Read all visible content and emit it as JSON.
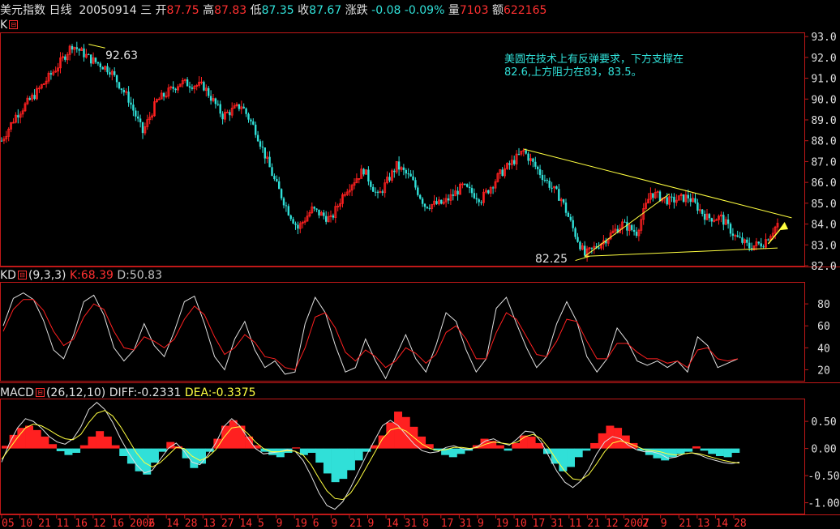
{
  "header": {
    "name": "美元指数 日线",
    "date": "20050914",
    "weekday": "三",
    "open_label": "开",
    "open": "87.75",
    "high_label": "高",
    "high": "87.83",
    "low_label": "低",
    "low": "87.35",
    "close_label": "收",
    "close": "87.67",
    "change_label": "涨跌",
    "change": "-0.08",
    "change_pct": "-0.09%",
    "volume_label": "量",
    "volume": "7103",
    "amount_label": "额",
    "amount": "622165"
  },
  "k_panel": {
    "label": "K",
    "annotation_lines": [
      "美圆在技术上有反弹要求，下方支撑在",
      "82.6,上方阻力在83，83.5。"
    ],
    "high_marker": "92.63",
    "low_marker": "82.25"
  },
  "kd_panel": {
    "label": "KD",
    "params": "(9,3,3)",
    "k_label": "K:68.39",
    "d_label": "D:50.83"
  },
  "macd_panel": {
    "label": "MACD",
    "params": "(26,12,10)",
    "diff_label": "DIFF:-0.2331",
    "dea_label": "DEA:-0.3375"
  },
  "x_axis_labels": [
    "05",
    "10",
    "21",
    "11",
    "16",
    "12",
    "16",
    "2006",
    "2",
    "14",
    "28",
    "13",
    "27",
    "14",
    "5",
    "9",
    "19",
    "6",
    "9",
    "21",
    "9",
    "14",
    "31",
    "8",
    "17",
    "31",
    "9",
    "19",
    "10",
    "17",
    "31",
    "11",
    "21",
    "12",
    "2007",
    "2",
    "9",
    "21",
    "13",
    "14",
    "28"
  ],
  "colors": {
    "up": "#ff2020",
    "down": "#30e0d8",
    "axis": "#c01818",
    "k_line": "#e0e0e0",
    "d_line": "#ff2020",
    "dea_line": "#ffff40",
    "trend": "#ffff40"
  },
  "chart_data": [
    {
      "type": "candlestick",
      "ylim": [
        82.0,
        93.2
      ],
      "yticks": [
        "93.0",
        "92.0",
        "91.0",
        "90.0",
        "89.0",
        "88.0",
        "87.0",
        "86.0",
        "85.0",
        "84.0",
        "83.0",
        "82.0"
      ],
      "points": [
        [
          0,
          88.0
        ],
        [
          6,
          89.2
        ],
        [
          14,
          90.2
        ],
        [
          24,
          91.6
        ],
        [
          30,
          92.6
        ],
        [
          38,
          91.9
        ],
        [
          46,
          91.4
        ],
        [
          54,
          90.0
        ],
        [
          60,
          88.4
        ],
        [
          66,
          89.9
        ],
        [
          76,
          90.8
        ],
        [
          86,
          90.6
        ],
        [
          94,
          89.2
        ],
        [
          102,
          89.7
        ],
        [
          108,
          88.5
        ],
        [
          116,
          86.1
        ],
        [
          122,
          84.6
        ],
        [
          126,
          83.8
        ],
        [
          132,
          84.7
        ],
        [
          140,
          84.2
        ],
        [
          146,
          85.6
        ],
        [
          154,
          86.6
        ],
        [
          160,
          85.3
        ],
        [
          168,
          86.8
        ],
        [
          174,
          86.2
        ],
        [
          180,
          84.9
        ],
        [
          188,
          85.0
        ],
        [
          196,
          85.8
        ],
        [
          204,
          85.2
        ],
        [
          212,
          86.4
        ],
        [
          222,
          87.5
        ],
        [
          230,
          86.3
        ],
        [
          238,
          85.2
        ],
        [
          244,
          83.5
        ],
        [
          248,
          82.5
        ],
        [
          256,
          83.2
        ],
        [
          264,
          84.0
        ],
        [
          270,
          83.6
        ],
        [
          276,
          85.5
        ],
        [
          284,
          85.1
        ],
        [
          292,
          85.3
        ],
        [
          300,
          84.3
        ],
        [
          306,
          84.3
        ],
        [
          312,
          83.4
        ],
        [
          318,
          82.9
        ],
        [
          324,
          83.1
        ],
        [
          330,
          84.0
        ]
      ],
      "trendlines": [
        [
          [
            222,
            87.6
          ],
          [
            336,
            84.3
          ]
        ],
        [
          [
            248,
            82.45
          ],
          [
            330,
            82.85
          ]
        ],
        [
          [
            248,
            82.45
          ],
          [
            284,
            85.45
          ]
        ]
      ]
    },
    {
      "type": "line",
      "ylim": [
        10,
        100
      ],
      "yticks": [
        "80",
        "60",
        "40",
        "20"
      ],
      "series": [
        {
          "name": "K",
          "values": [
            60,
            85,
            90,
            84,
            65,
            38,
            30,
            52,
            82,
            88,
            70,
            40,
            28,
            38,
            62,
            42,
            32,
            55,
            82,
            87,
            62,
            32,
            20,
            48,
            64,
            38,
            22,
            28,
            16,
            18,
            62,
            86,
            72,
            42,
            18,
            22,
            48,
            28,
            12,
            32,
            52,
            30,
            18,
            42,
            72,
            64,
            38,
            18,
            30,
            76,
            86,
            62,
            40,
            22,
            32,
            62,
            82,
            64,
            32,
            18,
            30,
            58,
            46,
            28,
            24,
            28,
            22,
            28,
            18,
            50,
            42,
            22,
            26,
            30
          ]
        },
        {
          "name": "D",
          "values": [
            55,
            75,
            84,
            84,
            74,
            55,
            42,
            48,
            68,
            80,
            75,
            55,
            40,
            38,
            50,
            46,
            40,
            48,
            66,
            78,
            70,
            50,
            34,
            40,
            52,
            45,
            32,
            30,
            22,
            20,
            40,
            68,
            72,
            58,
            36,
            28,
            38,
            32,
            22,
            28,
            40,
            35,
            26,
            34,
            54,
            60,
            48,
            30,
            30,
            54,
            72,
            66,
            50,
            34,
            32,
            46,
            66,
            64,
            46,
            30,
            30,
            44,
            44,
            36,
            30,
            30,
            26,
            28,
            22,
            38,
            40,
            30,
            28,
            30
          ]
        }
      ]
    },
    {
      "type": "bar",
      "ylim": [
        -1.2,
        0.92
      ],
      "yticks": [
        "0.50",
        "0.00",
        "-0.50",
        "-1.00"
      ],
      "histogram": [
        0.05,
        0.25,
        0.38,
        0.42,
        0.34,
        0.22,
        0.08,
        -0.05,
        -0.12,
        -0.08,
        0.06,
        0.22,
        0.32,
        0.22,
        0.06,
        -0.14,
        -0.28,
        -0.42,
        -0.48,
        -0.26,
        -0.06,
        0.12,
        0.04,
        -0.18,
        -0.36,
        -0.28,
        -0.06,
        0.18,
        0.42,
        0.52,
        0.42,
        0.22,
        0.06,
        -0.06,
        -0.12,
        -0.16,
        -0.08,
        0.02,
        -0.12,
        -0.08,
        -0.26,
        -0.46,
        -0.62,
        -0.56,
        -0.4,
        -0.22,
        -0.06,
        0.06,
        0.24,
        0.48,
        0.68,
        0.58,
        0.4,
        0.22,
        0.08,
        -0.04,
        -0.12,
        -0.16,
        -0.1,
        -0.04,
        0.06,
        0.18,
        0.14,
        0.06,
        -0.04,
        0.1,
        0.24,
        0.22,
        0.1,
        -0.1,
        -0.28,
        -0.42,
        -0.34,
        -0.16,
        -0.04,
        0.1,
        0.28,
        0.42,
        0.38,
        0.24,
        0.1,
        -0.04,
        -0.12,
        -0.18,
        -0.22,
        -0.16,
        -0.1,
        -0.06,
        0.04,
        -0.04,
        -0.1,
        -0.14,
        -0.16,
        -0.08
      ],
      "series": [
        {
          "name": "DIFF",
          "values": [
            -0.25,
            0.1,
            0.38,
            0.55,
            0.5,
            0.38,
            0.22,
            0.12,
            0.08,
            0.18,
            0.4,
            0.72,
            0.85,
            0.72,
            0.48,
            0.18,
            -0.08,
            -0.3,
            -0.45,
            -0.4,
            -0.2,
            0.0,
            0.1,
            -0.05,
            -0.25,
            -0.3,
            -0.12,
            0.1,
            0.4,
            0.55,
            0.42,
            0.2,
            0.0,
            -0.1,
            -0.08,
            -0.06,
            -0.02,
            -0.05,
            -0.22,
            -0.5,
            -0.82,
            -1.05,
            -1.12,
            -0.98,
            -0.72,
            -0.42,
            -0.12,
            0.15,
            0.42,
            0.52,
            0.42,
            0.25,
            0.08,
            -0.04,
            -0.08,
            -0.06,
            0.02,
            0.05,
            0.0,
            -0.02,
            0.04,
            0.14,
            0.18,
            0.1,
            0.06,
            0.18,
            0.32,
            0.3,
            0.12,
            -0.15,
            -0.42,
            -0.62,
            -0.72,
            -0.6,
            -0.38,
            -0.1,
            0.12,
            0.22,
            0.18,
            0.06,
            -0.02,
            -0.06,
            -0.06,
            -0.1,
            -0.18,
            -0.16,
            -0.1,
            -0.08,
            -0.12,
            -0.18,
            -0.22,
            -0.26,
            -0.28,
            -0.25
          ]
        },
        {
          "name": "DEA",
          "values": [
            -0.2,
            0.0,
            0.2,
            0.38,
            0.45,
            0.42,
            0.34,
            0.25,
            0.18,
            0.16,
            0.26,
            0.48,
            0.65,
            0.7,
            0.6,
            0.4,
            0.16,
            -0.08,
            -0.26,
            -0.34,
            -0.26,
            -0.12,
            0.02,
            0.0,
            -0.14,
            -0.22,
            -0.16,
            -0.02,
            0.2,
            0.38,
            0.4,
            0.28,
            0.12,
            0.0,
            -0.06,
            -0.06,
            -0.04,
            -0.05,
            -0.12,
            -0.3,
            -0.55,
            -0.78,
            -0.92,
            -0.94,
            -0.82,
            -0.6,
            -0.34,
            -0.08,
            0.18,
            0.34,
            0.38,
            0.32,
            0.2,
            0.08,
            0.0,
            -0.04,
            -0.02,
            0.02,
            0.02,
            0.0,
            0.02,
            0.08,
            0.12,
            0.1,
            0.08,
            0.12,
            0.22,
            0.26,
            0.18,
            0.0,
            -0.22,
            -0.42,
            -0.56,
            -0.58,
            -0.48,
            -0.28,
            -0.06,
            0.1,
            0.14,
            0.1,
            0.04,
            -0.02,
            -0.04,
            -0.06,
            -0.1,
            -0.12,
            -0.1,
            -0.08,
            -0.1,
            -0.14,
            -0.18,
            -0.22,
            -0.25,
            -0.27
          ]
        }
      ]
    }
  ]
}
